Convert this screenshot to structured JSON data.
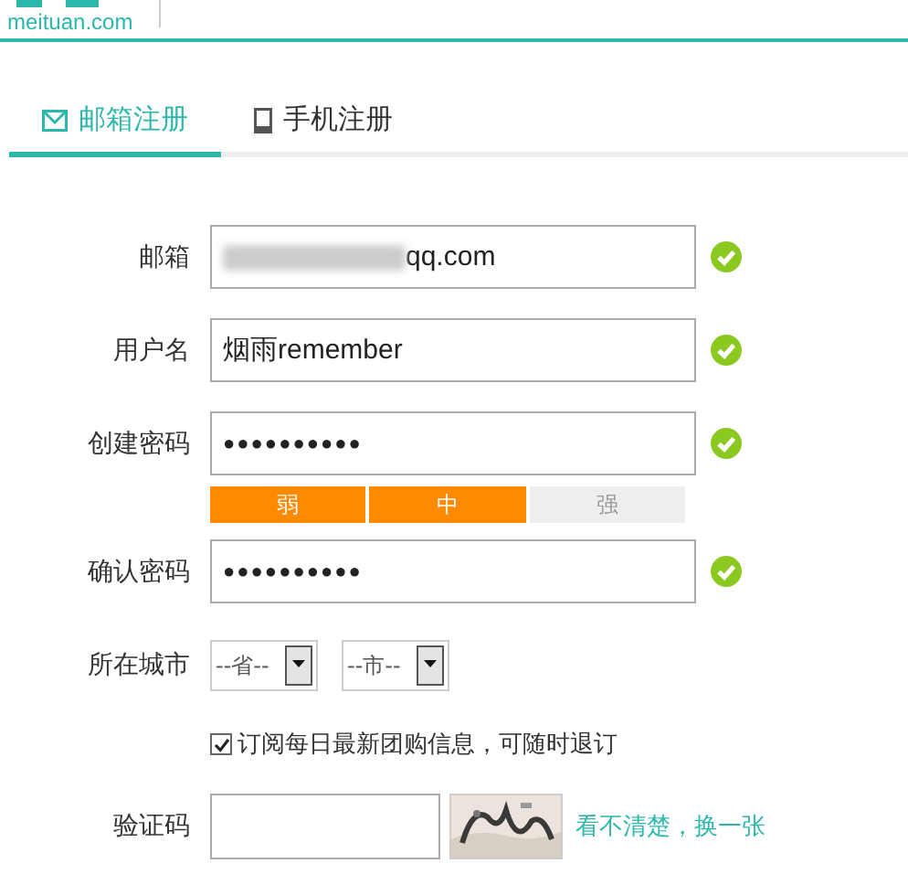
{
  "logo": {
    "text": "meituan.com"
  },
  "tabs": [
    {
      "label": "邮箱注册",
      "kind": "mail",
      "selected": true
    },
    {
      "label": "手机注册",
      "kind": "phone",
      "selected": false
    }
  ],
  "form": [
    {
      "kind": "text",
      "label": "邮箱",
      "value": "qq.com",
      "redacted": true,
      "valid": true
    },
    {
      "kind": "text",
      "label": "用户名",
      "value": "烟雨remember",
      "valid": true
    },
    {
      "kind": "password",
      "label": "创建密码",
      "value": "●●●●●●●●●●",
      "valid": true
    },
    {
      "kind": "strength",
      "segments": [
        {
          "label": "弱",
          "on": true
        },
        {
          "label": "中",
          "on": true
        },
        {
          "label": "强",
          "on": false
        }
      ]
    },
    {
      "kind": "password",
      "label": "确认密码",
      "value": "●●●●●●●●●●",
      "valid": true
    },
    {
      "kind": "selects",
      "label": "所在城市",
      "selects": [
        "--省--",
        "--市--"
      ]
    },
    {
      "kind": "checkbox",
      "label": "订阅每日最新团购信息，可随时退订",
      "checked": true
    },
    {
      "kind": "captcha",
      "label": "验证码",
      "link": "看不清楚，换一张"
    }
  ]
}
